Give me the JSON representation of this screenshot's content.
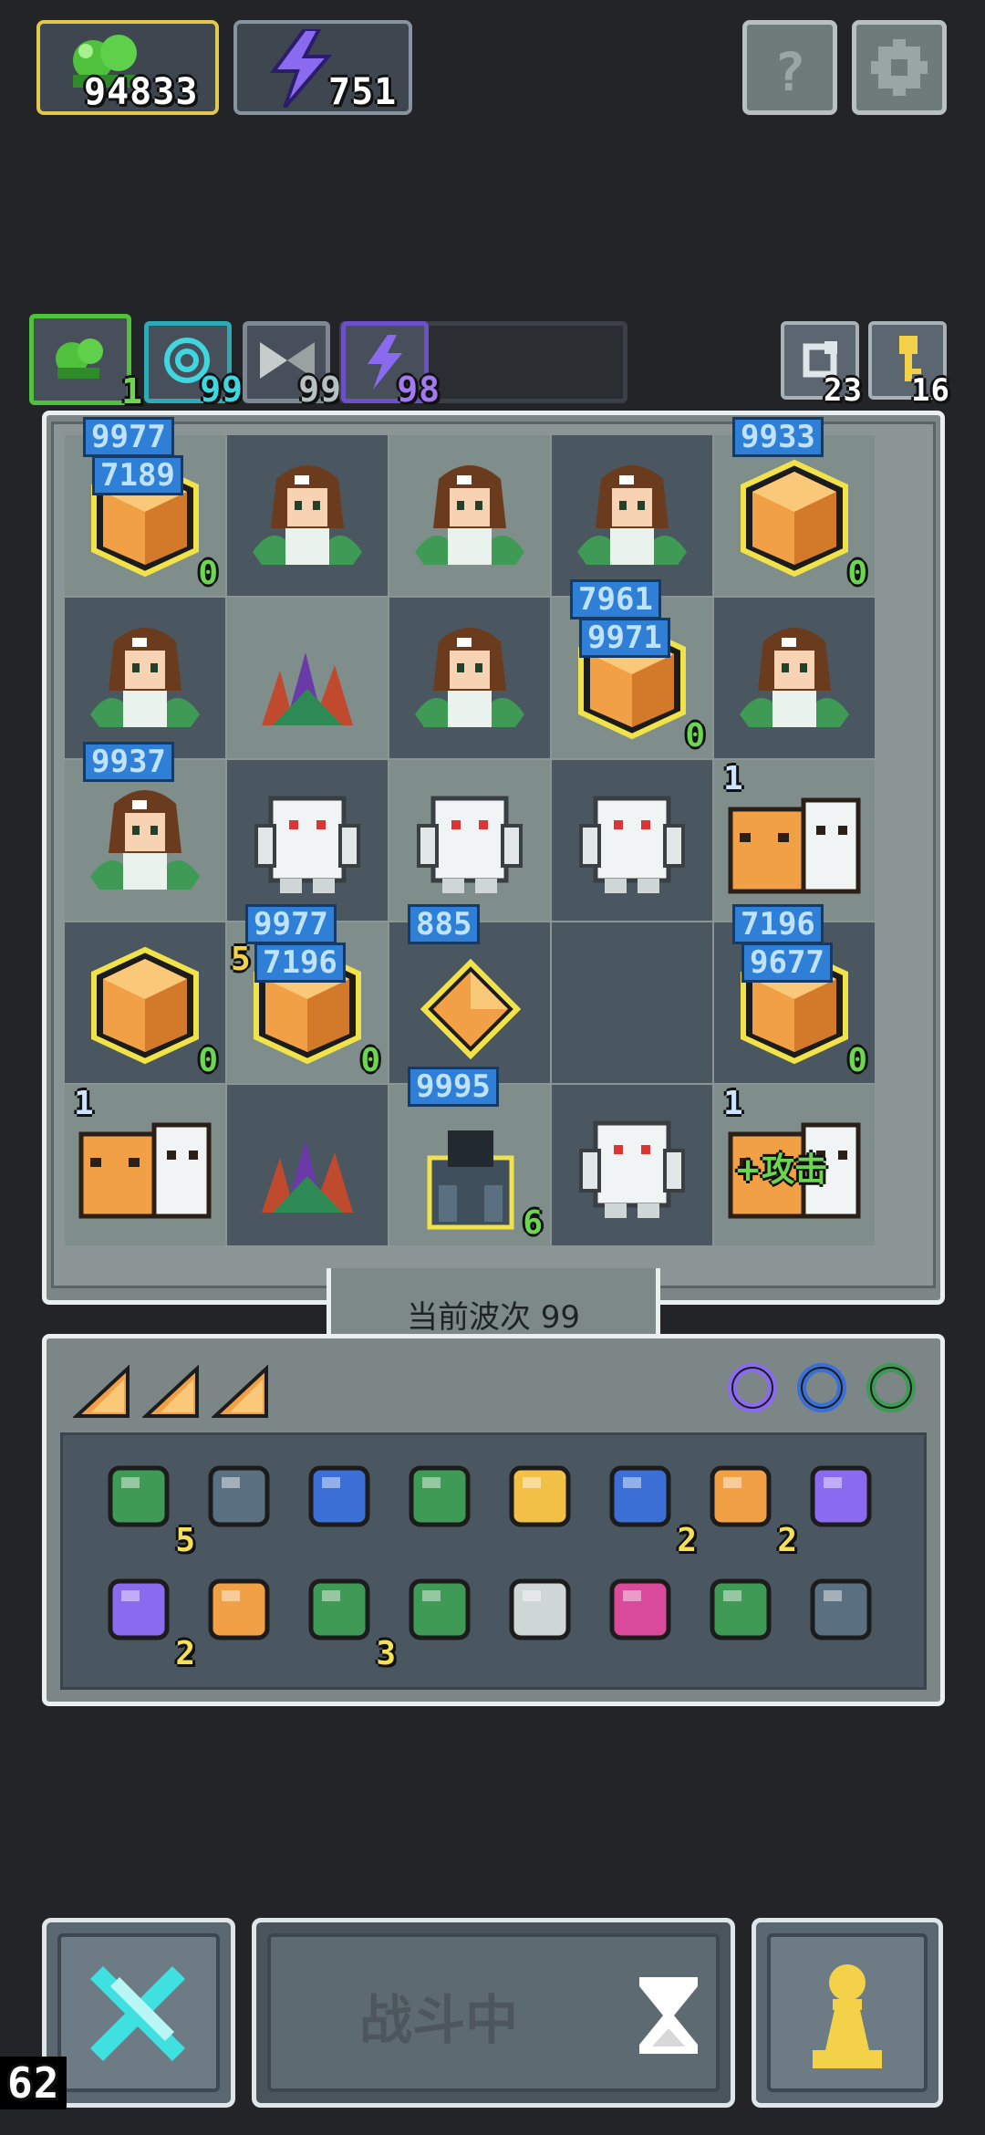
{
  "resources": {
    "gems": {
      "icon": "green-slime-icon",
      "value": "94833"
    },
    "energy": {
      "icon": "lightning-icon",
      "value": "751"
    }
  },
  "corner_buttons": [
    {
      "icon": "help-icon",
      "label": "?"
    },
    {
      "icon": "settings-gear-icon",
      "label": ""
    }
  ],
  "tabs": [
    {
      "icon": "slime-icon",
      "value": "1",
      "color": "#6cd552"
    },
    {
      "icon": "spiral-icon",
      "value": "99",
      "color": "#3fd6e0"
    },
    {
      "icon": "crossed-blades-icon",
      "value": "99",
      "color": "#b8c1c1"
    },
    {
      "icon": "lightning-icon",
      "value": "98",
      "color": "#a27af0"
    }
  ],
  "mini_buttons": [
    {
      "icon": "refresh-icon",
      "value": "23"
    },
    {
      "icon": "key-icon",
      "value": "16"
    }
  ],
  "board": {
    "cells": [
      {
        "type": "chest",
        "count": "0",
        "top": "9977",
        "bottom": "7189"
      },
      {
        "type": "girl"
      },
      {
        "type": "girl"
      },
      {
        "type": "girl"
      },
      {
        "type": "chest",
        "count": "0",
        "top": "9933",
        "bottom": ""
      },
      {
        "type": "girl"
      },
      {
        "type": "plant"
      },
      {
        "type": "girl"
      },
      {
        "type": "chest",
        "count": "0",
        "top": "7961",
        "bottom": "9971"
      },
      {
        "type": "girl"
      },
      {
        "type": "girl",
        "top": "9937"
      },
      {
        "type": "ghost"
      },
      {
        "type": "ghost"
      },
      {
        "type": "ghost"
      },
      {
        "type": "tiger",
        "count": "1"
      },
      {
        "type": "chest",
        "count": "0"
      },
      {
        "type": "chest",
        "count": "0",
        "top": "9977",
        "bottom": "7196",
        "side": "5"
      },
      {
        "type": "gem",
        "top": "885"
      },
      {
        "type": "empty"
      },
      {
        "type": "chest",
        "count": "0",
        "top": "7196",
        "bottom": "9677"
      },
      {
        "type": "tiger",
        "count": "1"
      },
      {
        "type": "plant"
      },
      {
        "type": "knight",
        "count": "6",
        "top": "9995"
      },
      {
        "type": "ghost"
      },
      {
        "type": "tiger",
        "count": "1",
        "label": "+攻击"
      }
    ],
    "wave_label": "当前波次 99"
  },
  "inventory": {
    "tabs": [
      {
        "icon": "cheese-icon"
      },
      {
        "icon": "cheese-icon"
      },
      {
        "icon": "cheese-icon"
      }
    ],
    "rings": [
      {
        "icon": "purple-ring-icon"
      },
      {
        "icon": "blue-ring-icon"
      },
      {
        "icon": "green-ring-icon"
      }
    ],
    "items": [
      {
        "icon": "goblin-icon",
        "count": "5"
      },
      {
        "icon": "shield-icon",
        "count": ""
      },
      {
        "icon": "helmet-icon",
        "count": ""
      },
      {
        "icon": "sword-icon",
        "count": ""
      },
      {
        "icon": "dagger-icon",
        "count": ""
      },
      {
        "icon": "hourglass-icon",
        "count": "2"
      },
      {
        "icon": "scroll-icon",
        "count": "2"
      },
      {
        "icon": "wand-icon",
        "count": ""
      },
      {
        "icon": "potion-icon",
        "count": "2"
      },
      {
        "icon": "crown-claw-icon",
        "count": ""
      },
      {
        "icon": "vine-icon",
        "count": "3"
      },
      {
        "icon": "arrow-icon",
        "count": ""
      },
      {
        "icon": "mirror-icon",
        "count": ""
      },
      {
        "icon": "pink-arrow-icon",
        "count": ""
      },
      {
        "icon": "chest-mimic-icon",
        "count": ""
      },
      {
        "icon": "spiky-crown-icon",
        "count": ""
      }
    ]
  },
  "bottom": {
    "left_button_icon": "crossed-swords-icon",
    "battle_label": "战斗中",
    "battle_icon": "hourglass-icon",
    "right_button_icon": "pawn-icon"
  },
  "fps": "62"
}
